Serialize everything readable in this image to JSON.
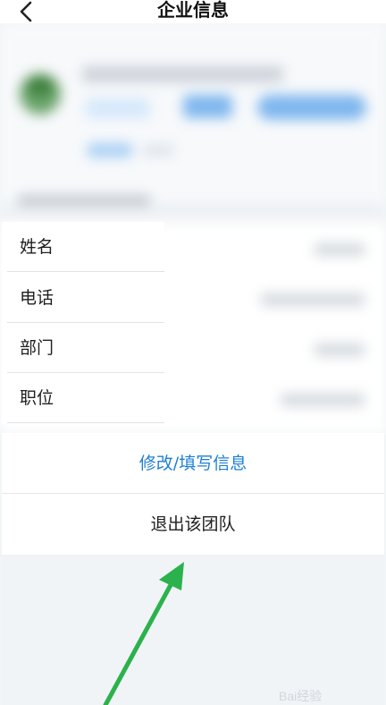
{
  "header": {
    "title": "企业信息",
    "back_icon": "chevron-left-icon"
  },
  "fields": [
    {
      "label": "姓名"
    },
    {
      "label": "电话"
    },
    {
      "label": "部门"
    },
    {
      "label": "职位"
    }
  ],
  "actions": {
    "edit_label": "修改/填写信息",
    "quit_label": "退出该团队"
  },
  "colors": {
    "accent_link": "#1d7fd3",
    "arrow": "#2bb24c",
    "text": "#1f1f1f"
  },
  "watermark": {
    "text": "Bai经验"
  }
}
